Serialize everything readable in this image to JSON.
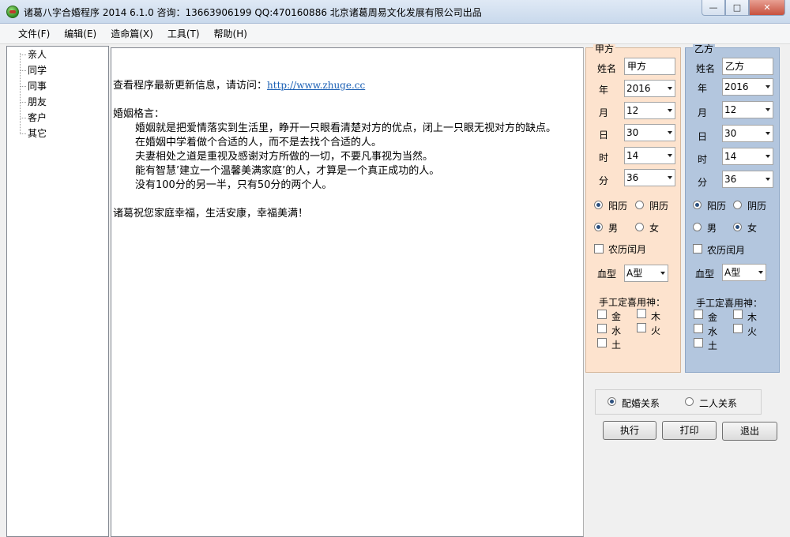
{
  "window": {
    "title": "诸葛八字合婚程序  2014 6.1.0  咨询：13663906199  QQ:470160886 北京诸葛周易文化发展有限公司出品",
    "buttons": {
      "minimize": "—",
      "maximize": "□",
      "close": "✕"
    }
  },
  "menu": [
    "文件(F)",
    "编辑(E)",
    "造命篇(X)",
    "工具(T)",
    "帮助(H)"
  ],
  "tree": [
    "亲人",
    "同学",
    "同事",
    "朋友",
    "客户",
    "其它"
  ],
  "content": {
    "update_prefix": "查看程序最新更新信息，请访问：",
    "update_link": "http://www.zhuge.cc",
    "motto_title": "婚姻格言：",
    "motto_1": "婚姻就是把爱情落实到生活里，睁开一只眼看清楚对方的优点，闭上一只眼无视对方的缺点。",
    "motto_2": "在婚姻中学着做个合适的人，而不是去找个合适的人。",
    "motto_3": "夫妻相处之道是重视及感谢对方所做的一切，不要凡事视为当然。",
    "motto_4": "能有智慧’建立一个温馨美满家庭’的人，才算是一个真正成功的人。",
    "motto_5": "没有100分的另一半，只有50分的两个人。",
    "blessing": "诸葛祝您家庭幸福，生活安康，幸福美满！"
  },
  "jia": {
    "title": "甲方",
    "name_label": "姓名",
    "name_value": "甲方",
    "year_label": "年",
    "year_value": "2016",
    "month_label": "月",
    "month_value": "12",
    "day_label": "日",
    "day_value": "30",
    "hour_label": "时",
    "hour_value": "14",
    "minute_label": "分",
    "minute_value": "36",
    "solar": "阳历",
    "lunar": "阴历",
    "calendar_selected": "阳历",
    "male": "男",
    "female": "女",
    "gender_selected": "男",
    "leap": "农历闰月",
    "blood_label": "血型",
    "blood_value": "A型",
    "manual_label": "手工定喜用神：",
    "elements": [
      "金",
      "木",
      "水",
      "火",
      "土"
    ]
  },
  "yi": {
    "title": "乙方",
    "name_label": "姓名",
    "name_value": "乙方",
    "year_label": "年",
    "year_value": "2016",
    "month_label": "月",
    "month_value": "12",
    "day_label": "日",
    "day_value": "30",
    "hour_label": "时",
    "hour_value": "14",
    "minute_label": "分",
    "minute_value": "36",
    "solar": "阳历",
    "lunar": "阴历",
    "calendar_selected": "阳历",
    "male": "男",
    "female": "女",
    "gender_selected": "女",
    "leap": "农历闰月",
    "blood_label": "血型",
    "blood_value": "A型",
    "manual_label": "手工定喜用神：",
    "elements": [
      "金",
      "木",
      "水",
      "火",
      "土"
    ]
  },
  "relation": {
    "marriage": "配婚关系",
    "pair": "二人关系",
    "selected": "配婚关系"
  },
  "actions": {
    "run": "执行",
    "print": "打印",
    "exit": "退出"
  }
}
